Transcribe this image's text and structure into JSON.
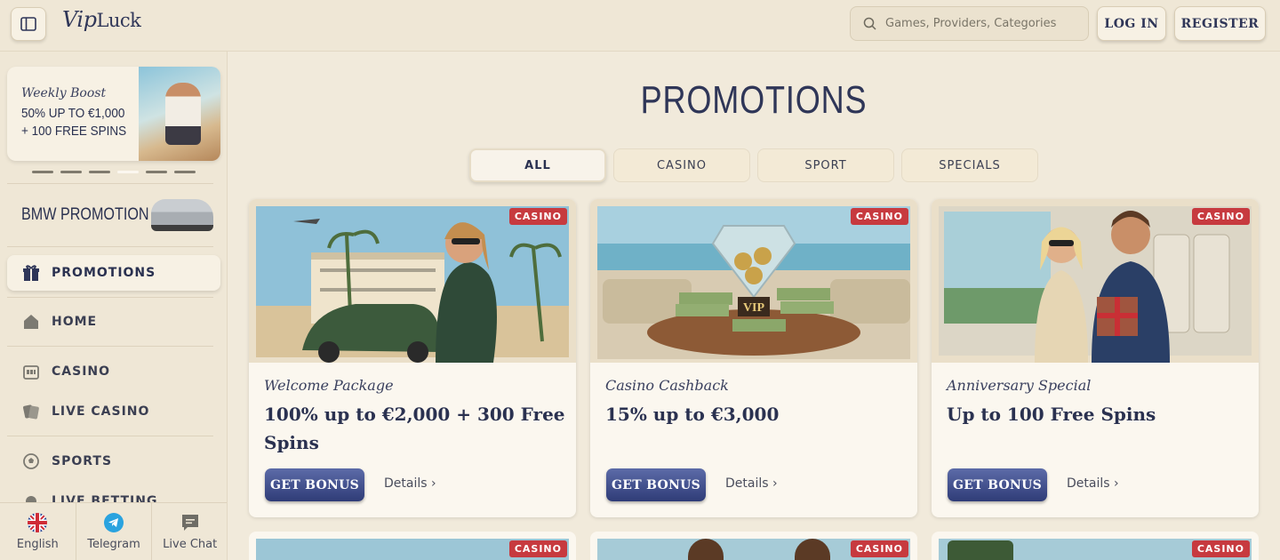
{
  "header": {
    "logo_script": "Vip",
    "logo_text": "Luck",
    "search_placeholder": "Games, Providers, Categories",
    "login_label": "LOG IN",
    "register_label": "REGISTER"
  },
  "sidebar": {
    "boost": {
      "title": "Weekly Boost",
      "line1": "50% UP TO €1,000",
      "line2": "+ 100 FREE SPINS"
    },
    "bmw_label": "BMW PROMOTION",
    "nav": [
      {
        "label": "PROMOTIONS",
        "icon": "gift-icon",
        "active": true
      },
      {
        "label": "HOME",
        "icon": "home-icon"
      },
      {
        "label": "CASINO",
        "icon": "casino-icon"
      },
      {
        "label": "LIVE CASINO",
        "icon": "cards-icon"
      },
      {
        "label": "SPORTS",
        "icon": "ball-icon"
      },
      {
        "label": "LIVE BETTING",
        "icon": "live-icon"
      }
    ],
    "bottom": [
      {
        "label": "English",
        "icon": "uk-flag-icon"
      },
      {
        "label": "Telegram",
        "icon": "telegram-icon"
      },
      {
        "label": "Live Chat",
        "icon": "chat-icon"
      }
    ]
  },
  "main": {
    "title": "PROMOTIONS",
    "tabs": [
      "ALL",
      "CASINO",
      "SPORT",
      "SPECIALS"
    ],
    "cards": [
      {
        "badge": "CASINO",
        "subtitle": "Welcome Package",
        "title": "100% up to €2,000 + 300 Free Spins",
        "button": "GET BONUS",
        "details": "Details"
      },
      {
        "badge": "CASINO",
        "subtitle": "Casino Cashback",
        "title": "15% up to €3,000",
        "button": "GET BONUS",
        "details": "Details"
      },
      {
        "badge": "CASINO",
        "subtitle": "Anniversary Special",
        "title": "Up to 100 Free Spins",
        "button": "GET BONUS",
        "details": "Details"
      }
    ],
    "next_row_badges": [
      "CASINO",
      "CASINO",
      "CASINO"
    ]
  },
  "colors": {
    "background": "#f1eadb",
    "navy": "#2f3658",
    "badge_red": "#c73a3f",
    "button_blue": "#3b4a8a"
  }
}
